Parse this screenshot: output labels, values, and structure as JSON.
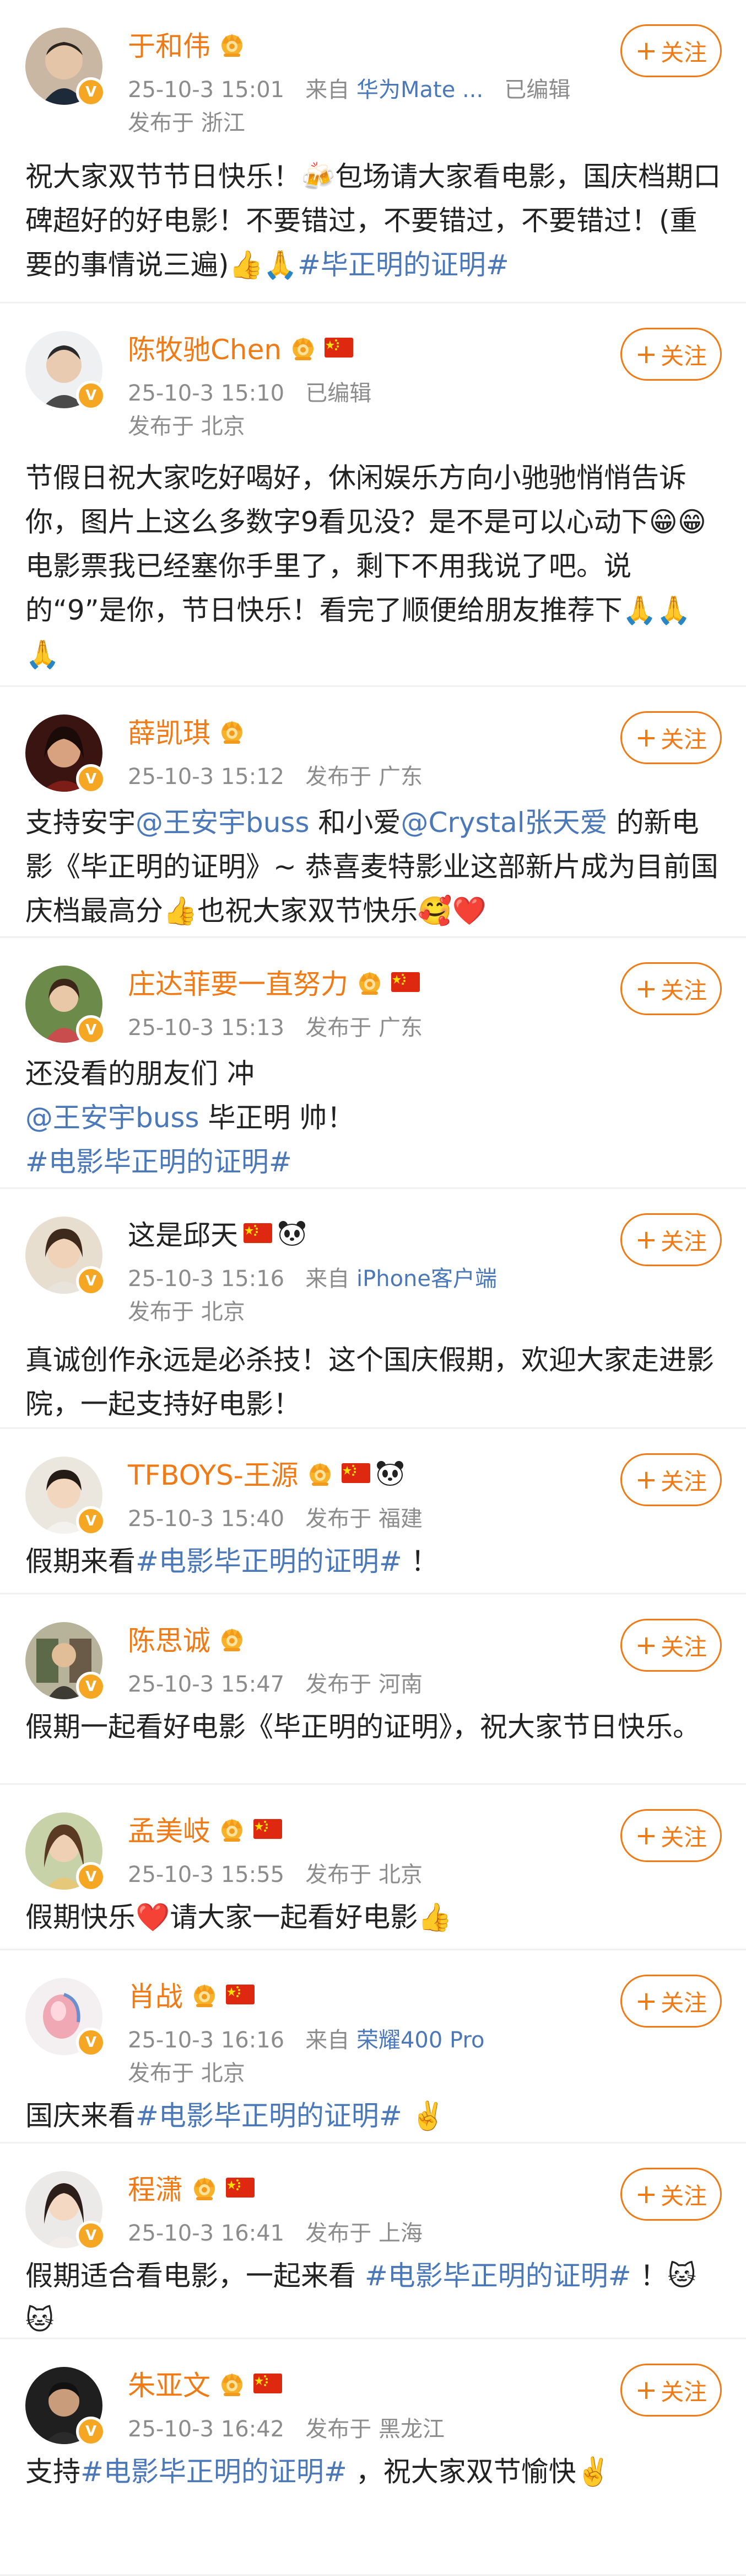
{
  "colors": {
    "name": "#f07a15",
    "link": "#4b78b8",
    "meta": "#8c8c8c",
    "badge": "#f5a623"
  },
  "follow_label": "关注",
  "posts": [
    {
      "name": "于和伟",
      "time": "25-10-3 15:01",
      "from_prefix": "来自",
      "source": "华为Mate ...",
      "edited": "已编辑",
      "location": "发布于 浙江",
      "text_before": "祝大家双节节日快乐！🍻包场请大家看电影，国庆档期口碑超好的好电影！不要错过，不要错过，不要错过！(重要的事情说三遍)👍🙏",
      "hashtag": "#毕正明的证明#",
      "text_after": ""
    },
    {
      "name": "陈牧驰Chen",
      "time": "25-10-3 15:10",
      "edited": "已编辑",
      "location": "发布于 北京",
      "text_before": "节假日祝大家吃好喝好，休闲娱乐方向小驰驰悄悄告诉你，图片上这么多数字9看见没？是不是可以心动下😁😁电影票我已经塞你手里了，剩下不用我说了吧。说的“9”是你，节日快乐！看完了顺便给朋友推荐下🙏🙏🙏"
    },
    {
      "name": "薛凯琪",
      "time": "25-10-3 15:12",
      "location": "发布于 广东",
      "seg1": "支持安宇",
      "mention1": "@王安宇buss",
      "seg2": " 和小爱",
      "mention2": "@Crystal张天爱",
      "seg3": " 的新电影《毕正明的证明》~ 恭喜麦特影业这部新片成为目前国庆档最高分👍也祝大家双节快乐🥰❤️"
    },
    {
      "name": "庄达菲要一直努力",
      "time": "25-10-3 15:13",
      "location": "发布于 广东",
      "line1": "还没看的朋友们 冲",
      "mention": "@王安宇buss",
      "line2": " 毕正明 帅！",
      "hashtag": "#电影毕正明的证明#"
    },
    {
      "name": "这是邱天",
      "time": "25-10-3 15:16",
      "from_prefix": "来自",
      "source": "iPhone客户端",
      "location": "发布于 北京",
      "text": "真诚创作永远是必杀技！这个国庆假期，欢迎大家走进影院，一起支持好电影！"
    },
    {
      "name": "TFBOYS-王源",
      "time": "25-10-3 15:40",
      "location": "发布于 福建",
      "seg1": "假期来看",
      "hashtag": "#电影毕正明的证明#",
      "seg2": " ！"
    },
    {
      "name": "陈思诚",
      "time": "25-10-3 15:47",
      "location": "发布于 河南",
      "text": "假期一起看好电影《毕正明的证明》，祝大家节日快乐。"
    },
    {
      "name": "孟美岐",
      "time": "25-10-3 15:55",
      "location": "发布于 北京",
      "text": "假期快乐❤️请大家一起看好电影👍"
    },
    {
      "name": "肖战",
      "time": "25-10-3 16:16",
      "from_prefix": "来自",
      "source": "荣耀400 Pro",
      "location": "发布于 北京",
      "seg1": "国庆来看",
      "hashtag": "#电影毕正明的证明#",
      "seg2": " ✌️"
    },
    {
      "name": "程潇",
      "time": "25-10-3 16:41",
      "location": "发布于 上海",
      "seg1": "假期适合看电影，一起来看 ",
      "hashtag": "#电影毕正明的证明#",
      "seg2": " ！🐱🐱"
    },
    {
      "name": "朱亚文",
      "time": "25-10-3 16:42",
      "location": "发布于 黑龙江",
      "seg1": "支持",
      "hashtag": "#电影毕正明的证明#",
      "seg2": " ，祝大家双节愉快✌️"
    }
  ]
}
